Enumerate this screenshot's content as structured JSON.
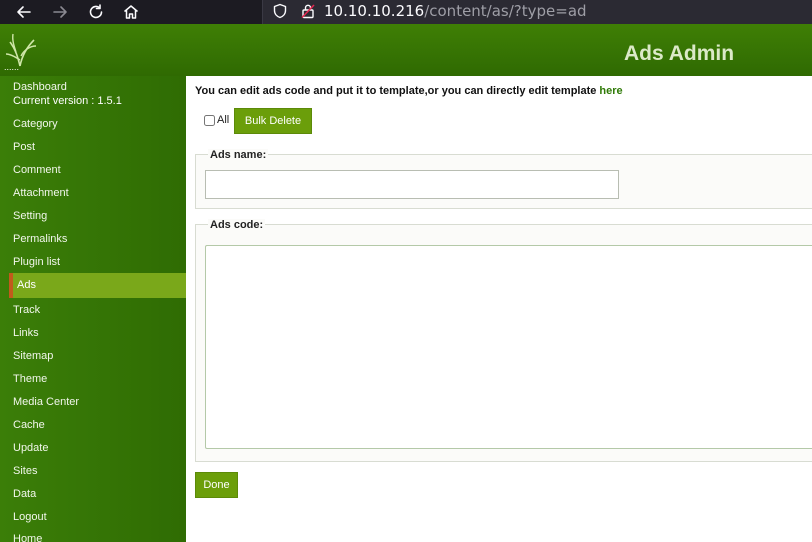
{
  "browser": {
    "url_host": "10.10.10.216",
    "url_path": "/content/as/?type=ad"
  },
  "header": {
    "logo_dots": "......",
    "title": "Ads Admin"
  },
  "sidebar": {
    "items": [
      {
        "label": "Dashboard"
      },
      {
        "label": "Current version : 1.5.1"
      },
      {
        "label": "Category"
      },
      {
        "label": "Post"
      },
      {
        "label": "Comment"
      },
      {
        "label": "Attachment"
      },
      {
        "label": "Setting"
      },
      {
        "label": "Permalinks"
      },
      {
        "label": "Plugin list"
      },
      {
        "label": "Ads",
        "active": true
      },
      {
        "label": "Track"
      },
      {
        "label": "Links"
      },
      {
        "label": "Sitemap"
      },
      {
        "label": "Theme"
      },
      {
        "label": "Media Center"
      },
      {
        "label": "Cache"
      },
      {
        "label": "Update"
      },
      {
        "label": "Sites"
      },
      {
        "label": "Data"
      },
      {
        "label": "Logout"
      },
      {
        "label": "Home"
      }
    ]
  },
  "main": {
    "intro_text": "You can edit ads code and put it to template,or you can directly edit template ",
    "intro_link": "here",
    "all_label": "All",
    "bulk_delete_label": "Bulk Delete",
    "ads_name_legend": "Ads name:",
    "ads_name_value": "",
    "ads_code_legend": "Ads code:",
    "ads_code_value": "",
    "done_label": "Done"
  },
  "colors": {
    "brand_green": "#3b7e08",
    "button_green": "#6b9e0a",
    "active_marker": "#c25b1c"
  }
}
